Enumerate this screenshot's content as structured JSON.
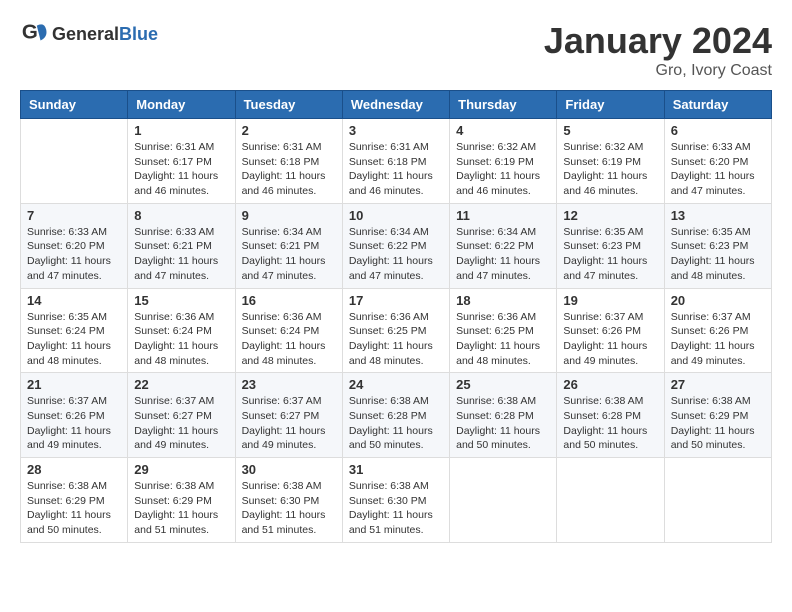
{
  "header": {
    "logo_general": "General",
    "logo_blue": "Blue",
    "month": "January 2024",
    "location": "Gro, Ivory Coast"
  },
  "weekdays": [
    "Sunday",
    "Monday",
    "Tuesday",
    "Wednesday",
    "Thursday",
    "Friday",
    "Saturday"
  ],
  "weeks": [
    [
      {
        "day": "",
        "info": ""
      },
      {
        "day": "1",
        "info": "Sunrise: 6:31 AM\nSunset: 6:17 PM\nDaylight: 11 hours\nand 46 minutes."
      },
      {
        "day": "2",
        "info": "Sunrise: 6:31 AM\nSunset: 6:18 PM\nDaylight: 11 hours\nand 46 minutes."
      },
      {
        "day": "3",
        "info": "Sunrise: 6:31 AM\nSunset: 6:18 PM\nDaylight: 11 hours\nand 46 minutes."
      },
      {
        "day": "4",
        "info": "Sunrise: 6:32 AM\nSunset: 6:19 PM\nDaylight: 11 hours\nand 46 minutes."
      },
      {
        "day": "5",
        "info": "Sunrise: 6:32 AM\nSunset: 6:19 PM\nDaylight: 11 hours\nand 46 minutes."
      },
      {
        "day": "6",
        "info": "Sunrise: 6:33 AM\nSunset: 6:20 PM\nDaylight: 11 hours\nand 47 minutes."
      }
    ],
    [
      {
        "day": "7",
        "info": "Sunrise: 6:33 AM\nSunset: 6:20 PM\nDaylight: 11 hours\nand 47 minutes."
      },
      {
        "day": "8",
        "info": "Sunrise: 6:33 AM\nSunset: 6:21 PM\nDaylight: 11 hours\nand 47 minutes."
      },
      {
        "day": "9",
        "info": "Sunrise: 6:34 AM\nSunset: 6:21 PM\nDaylight: 11 hours\nand 47 minutes."
      },
      {
        "day": "10",
        "info": "Sunrise: 6:34 AM\nSunset: 6:22 PM\nDaylight: 11 hours\nand 47 minutes."
      },
      {
        "day": "11",
        "info": "Sunrise: 6:34 AM\nSunset: 6:22 PM\nDaylight: 11 hours\nand 47 minutes."
      },
      {
        "day": "12",
        "info": "Sunrise: 6:35 AM\nSunset: 6:23 PM\nDaylight: 11 hours\nand 47 minutes."
      },
      {
        "day": "13",
        "info": "Sunrise: 6:35 AM\nSunset: 6:23 PM\nDaylight: 11 hours\nand 48 minutes."
      }
    ],
    [
      {
        "day": "14",
        "info": "Sunrise: 6:35 AM\nSunset: 6:24 PM\nDaylight: 11 hours\nand 48 minutes."
      },
      {
        "day": "15",
        "info": "Sunrise: 6:36 AM\nSunset: 6:24 PM\nDaylight: 11 hours\nand 48 minutes."
      },
      {
        "day": "16",
        "info": "Sunrise: 6:36 AM\nSunset: 6:24 PM\nDaylight: 11 hours\nand 48 minutes."
      },
      {
        "day": "17",
        "info": "Sunrise: 6:36 AM\nSunset: 6:25 PM\nDaylight: 11 hours\nand 48 minutes."
      },
      {
        "day": "18",
        "info": "Sunrise: 6:36 AM\nSunset: 6:25 PM\nDaylight: 11 hours\nand 48 minutes."
      },
      {
        "day": "19",
        "info": "Sunrise: 6:37 AM\nSunset: 6:26 PM\nDaylight: 11 hours\nand 49 minutes."
      },
      {
        "day": "20",
        "info": "Sunrise: 6:37 AM\nSunset: 6:26 PM\nDaylight: 11 hours\nand 49 minutes."
      }
    ],
    [
      {
        "day": "21",
        "info": "Sunrise: 6:37 AM\nSunset: 6:26 PM\nDaylight: 11 hours\nand 49 minutes."
      },
      {
        "day": "22",
        "info": "Sunrise: 6:37 AM\nSunset: 6:27 PM\nDaylight: 11 hours\nand 49 minutes."
      },
      {
        "day": "23",
        "info": "Sunrise: 6:37 AM\nSunset: 6:27 PM\nDaylight: 11 hours\nand 49 minutes."
      },
      {
        "day": "24",
        "info": "Sunrise: 6:38 AM\nSunset: 6:28 PM\nDaylight: 11 hours\nand 50 minutes."
      },
      {
        "day": "25",
        "info": "Sunrise: 6:38 AM\nSunset: 6:28 PM\nDaylight: 11 hours\nand 50 minutes."
      },
      {
        "day": "26",
        "info": "Sunrise: 6:38 AM\nSunset: 6:28 PM\nDaylight: 11 hours\nand 50 minutes."
      },
      {
        "day": "27",
        "info": "Sunrise: 6:38 AM\nSunset: 6:29 PM\nDaylight: 11 hours\nand 50 minutes."
      }
    ],
    [
      {
        "day": "28",
        "info": "Sunrise: 6:38 AM\nSunset: 6:29 PM\nDaylight: 11 hours\nand 50 minutes."
      },
      {
        "day": "29",
        "info": "Sunrise: 6:38 AM\nSunset: 6:29 PM\nDaylight: 11 hours\nand 51 minutes."
      },
      {
        "day": "30",
        "info": "Sunrise: 6:38 AM\nSunset: 6:30 PM\nDaylight: 11 hours\nand 51 minutes."
      },
      {
        "day": "31",
        "info": "Sunrise: 6:38 AM\nSunset: 6:30 PM\nDaylight: 11 hours\nand 51 minutes."
      },
      {
        "day": "",
        "info": ""
      },
      {
        "day": "",
        "info": ""
      },
      {
        "day": "",
        "info": ""
      }
    ]
  ]
}
